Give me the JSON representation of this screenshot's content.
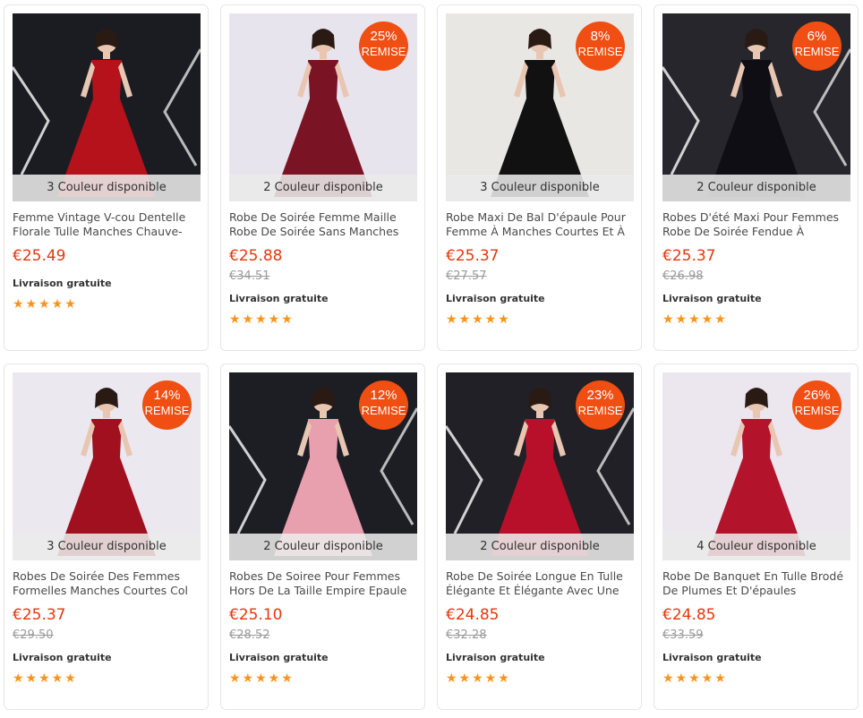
{
  "products": [
    {
      "colors": "3 Couleur disponible",
      "title": "Femme Vintage V-cou Dentelle Florale Tulle Manches Chauve-",
      "price": "€25.49",
      "old_price": "",
      "discount": "",
      "remise": "",
      "shipping": "Livraison gratuite",
      "rating": "★★★★★",
      "dress_color": "#b5121b",
      "bg_color": "#1b1b22"
    },
    {
      "colors": "2 Couleur disponible",
      "title": "Robe De Soirée Femme Maille Robe De Soirée Sans Manches",
      "price": "€25.88",
      "old_price": "€34.51",
      "discount": "25%",
      "remise": "REMISE",
      "shipping": "Livraison gratuite",
      "rating": "★★★★★",
      "dress_color": "#7a1424",
      "bg_color": "#e8e4ee"
    },
    {
      "colors": "3 Couleur disponible",
      "title": "Robe Maxi De Bal D'épaule Pour Femme À Manches Courtes Et À",
      "price": "€25.37",
      "old_price": "€27.57",
      "discount": "8%",
      "remise": "REMISE",
      "shipping": "Livraison gratuite",
      "rating": "★★★★★",
      "dress_color": "#111111",
      "bg_color": "#e9e7e4"
    },
    {
      "colors": "2 Couleur disponible",
      "title": "Robes D'été Maxi Pour Femmes Robe De Soirée Fendue À",
      "price": "€25.37",
      "old_price": "€26.98",
      "discount": "6%",
      "remise": "REMISE",
      "shipping": "Livraison gratuite",
      "rating": "★★★★★",
      "dress_color": "#0e0e14",
      "bg_color": "#26262c"
    },
    {
      "colors": "3 Couleur disponible",
      "title": "Robes De Soirée Des Femmes Formelles Manches Courtes Col",
      "price": "€25.37",
      "old_price": "€29.50",
      "discount": "14%",
      "remise": "REMISE",
      "shipping": "Livraison gratuite",
      "rating": "★★★★★",
      "dress_color": "#a0101e",
      "bg_color": "#ece8f0"
    },
    {
      "colors": "2 Couleur disponible",
      "title": "Robes De Soiree Pour Femmes Hors De La Taille Empire Epaule",
      "price": "€25.10",
      "old_price": "€28.52",
      "discount": "12%",
      "remise": "REMISE",
      "shipping": "Livraison gratuite",
      "rating": "★★★★★",
      "dress_color": "#e8a0ae",
      "bg_color": "#1d1d24"
    },
    {
      "colors": "2 Couleur disponible",
      "title": "Robe De Soirée Longue En Tulle Élégante Et Élégante Avec Une",
      "price": "€24.85",
      "old_price": "€32.28",
      "discount": "23%",
      "remise": "REMISE",
      "shipping": "Livraison gratuite",
      "rating": "★★★★★",
      "dress_color": "#b8102a",
      "bg_color": "#202026"
    },
    {
      "colors": "4 Couleur disponible",
      "title": "Robe De Banquet En Tulle Brodé De Plumes Et D'épaules",
      "price": "€24.85",
      "old_price": "€33.59",
      "discount": "26%",
      "remise": "REMISE",
      "shipping": "Livraison gratuite",
      "rating": "★★★★★",
      "dress_color": "#b3142c",
      "bg_color": "#ece6ee"
    }
  ]
}
